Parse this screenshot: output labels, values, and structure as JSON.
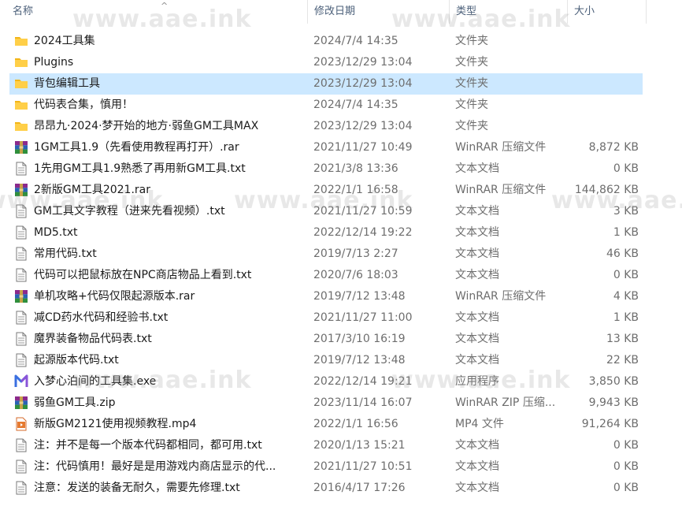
{
  "header": {
    "name": "名称",
    "date": "修改日期",
    "type": "类型",
    "size": "大小",
    "sort_arrow": "^"
  },
  "watermark_text": "www.aae.ink",
  "files": [
    {
      "name": "2024工具集",
      "date": "2024/7/4 14:35",
      "type": "文件夹",
      "size": "",
      "icon": "folder-icon"
    },
    {
      "name": "Plugins",
      "date": "2023/12/29 13:04",
      "type": "文件夹",
      "size": "",
      "icon": "folder-icon"
    },
    {
      "name": "背包编辑工具",
      "date": "2023/12/29 13:04",
      "type": "文件夹",
      "size": "",
      "icon": "folder-icon",
      "selected": true
    },
    {
      "name": "代码表合集，慎用！",
      "date": "2024/7/4 14:35",
      "type": "文件夹",
      "size": "",
      "icon": "folder-icon"
    },
    {
      "name": "昂昂九·2024·梦开始的地方·弱鱼GM工具MAX",
      "date": "2023/12/29 13:04",
      "type": "文件夹",
      "size": "",
      "icon": "folder-icon"
    },
    {
      "name": "1GM工具1.9（先看使用教程再打开）.rar",
      "date": "2021/11/27 10:49",
      "type": "WinRAR 压缩文件",
      "size": "8,872 KB",
      "icon": "winrar-icon"
    },
    {
      "name": "1先用GM工具1.9熟悉了再用新GM工具.txt",
      "date": "2021/3/8 13:36",
      "type": "文本文档",
      "size": "0 KB",
      "icon": "text-file-icon"
    },
    {
      "name": "2新版GM工具2021.rar",
      "date": "2022/1/1 16:58",
      "type": "WinRAR 压缩文件",
      "size": "144,862 KB",
      "icon": "winrar-icon"
    },
    {
      "name": "GM工具文字教程（进来先看视频）.txt",
      "date": "2021/11/27 10:59",
      "type": "文本文档",
      "size": "3 KB",
      "icon": "text-file-icon"
    },
    {
      "name": "MD5.txt",
      "date": "2022/12/14 19:22",
      "type": "文本文档",
      "size": "1 KB",
      "icon": "text-file-icon"
    },
    {
      "name": "常用代码.txt",
      "date": "2019/7/13 2:27",
      "type": "文本文档",
      "size": "46 KB",
      "icon": "text-file-icon"
    },
    {
      "name": "代码可以把鼠标放在NPC商店物品上看到.txt",
      "date": "2020/7/6 18:03",
      "type": "文本文档",
      "size": "0 KB",
      "icon": "text-file-icon"
    },
    {
      "name": "单机攻略+代码仅限起源版本.rar",
      "date": "2019/7/12 13:48",
      "type": "WinRAR 压缩文件",
      "size": "4 KB",
      "icon": "winrar-icon"
    },
    {
      "name": "减CD药水代码和经验书.txt",
      "date": "2021/11/27 11:00",
      "type": "文本文档",
      "size": "1 KB",
      "icon": "text-file-icon"
    },
    {
      "name": "魔界装备物品代码表.txt",
      "date": "2017/3/10 16:19",
      "type": "文本文档",
      "size": "13 KB",
      "icon": "text-file-icon"
    },
    {
      "name": "起源版本代码.txt",
      "date": "2019/7/12 13:48",
      "type": "文本文档",
      "size": "22 KB",
      "icon": "text-file-icon"
    },
    {
      "name": "入梦心泊间的工具集.exe",
      "date": "2022/12/14 19:21",
      "type": "应用程序",
      "size": "3,850 KB",
      "icon": "app-m-icon"
    },
    {
      "name": "弱鱼GM工具.zip",
      "date": "2023/11/14 16:07",
      "type": "WinRAR ZIP 压缩...",
      "size": "9,943 KB",
      "icon": "winrar-icon"
    },
    {
      "name": "新版GM2121使用视频教程.mp4",
      "date": "2022/1/1 16:56",
      "type": "MP4 文件",
      "size": "91,264 KB",
      "icon": "video-file-icon"
    },
    {
      "name": "注：并不是每一个版本代码都相同，都可用.txt",
      "date": "2020/1/13 15:21",
      "type": "文本文档",
      "size": "0 KB",
      "icon": "text-file-icon"
    },
    {
      "name": "注：代码慎用！最好是是用游戏内商店显示的代...",
      "date": "2021/11/27 10:51",
      "type": "文本文档",
      "size": "0 KB",
      "icon": "text-file-icon"
    },
    {
      "name": "注意：发送的装备无耐久，需要先修理.txt",
      "date": "2016/4/17 17:26",
      "type": "文本文档",
      "size": "0 KB",
      "icon": "text-file-icon"
    }
  ]
}
